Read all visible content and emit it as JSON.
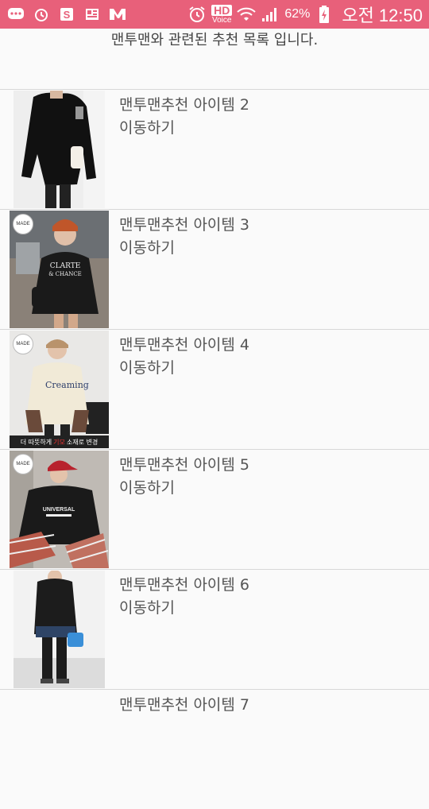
{
  "status_bar": {
    "battery": "62%",
    "time": "오전 12:50",
    "hd": "HD",
    "voice": "Voice",
    "icons": [
      "chat-icon",
      "alarm-icon",
      "s-app-icon",
      "news-icon",
      "m-app-icon",
      "alarm-clock-icon",
      "wifi-icon",
      "signal-icon",
      "battery-charging-icon"
    ]
  },
  "header": {
    "text": "맨투맨와 관련된 추천 목록 입니다."
  },
  "items": [
    {
      "title": "맨투맨추천 아이템 2",
      "link": "이동하기"
    },
    {
      "title": "맨투맨추천 아이템 3",
      "link": "이동하기",
      "badge": "MADE"
    },
    {
      "title": "맨투맨추천 아이템 4",
      "link": "이동하기",
      "badge": "MADE",
      "banner_pre": "더 따뜻하게",
      "banner_red": "기모",
      "banner_post": "소재로 변경",
      "shirt_text": "Creaming"
    },
    {
      "title": "맨투맨추천 아이템 5",
      "link": "이동하기",
      "badge": "MADE"
    },
    {
      "title": "맨투맨추천 아이템 6",
      "link": "이동하기"
    },
    {
      "title": "맨투맨추천 아이템 7"
    }
  ],
  "colors": {
    "status_bar": "#e8607a",
    "background": "#fafafa",
    "text": "#555555",
    "divider": "#d8d8d8"
  }
}
